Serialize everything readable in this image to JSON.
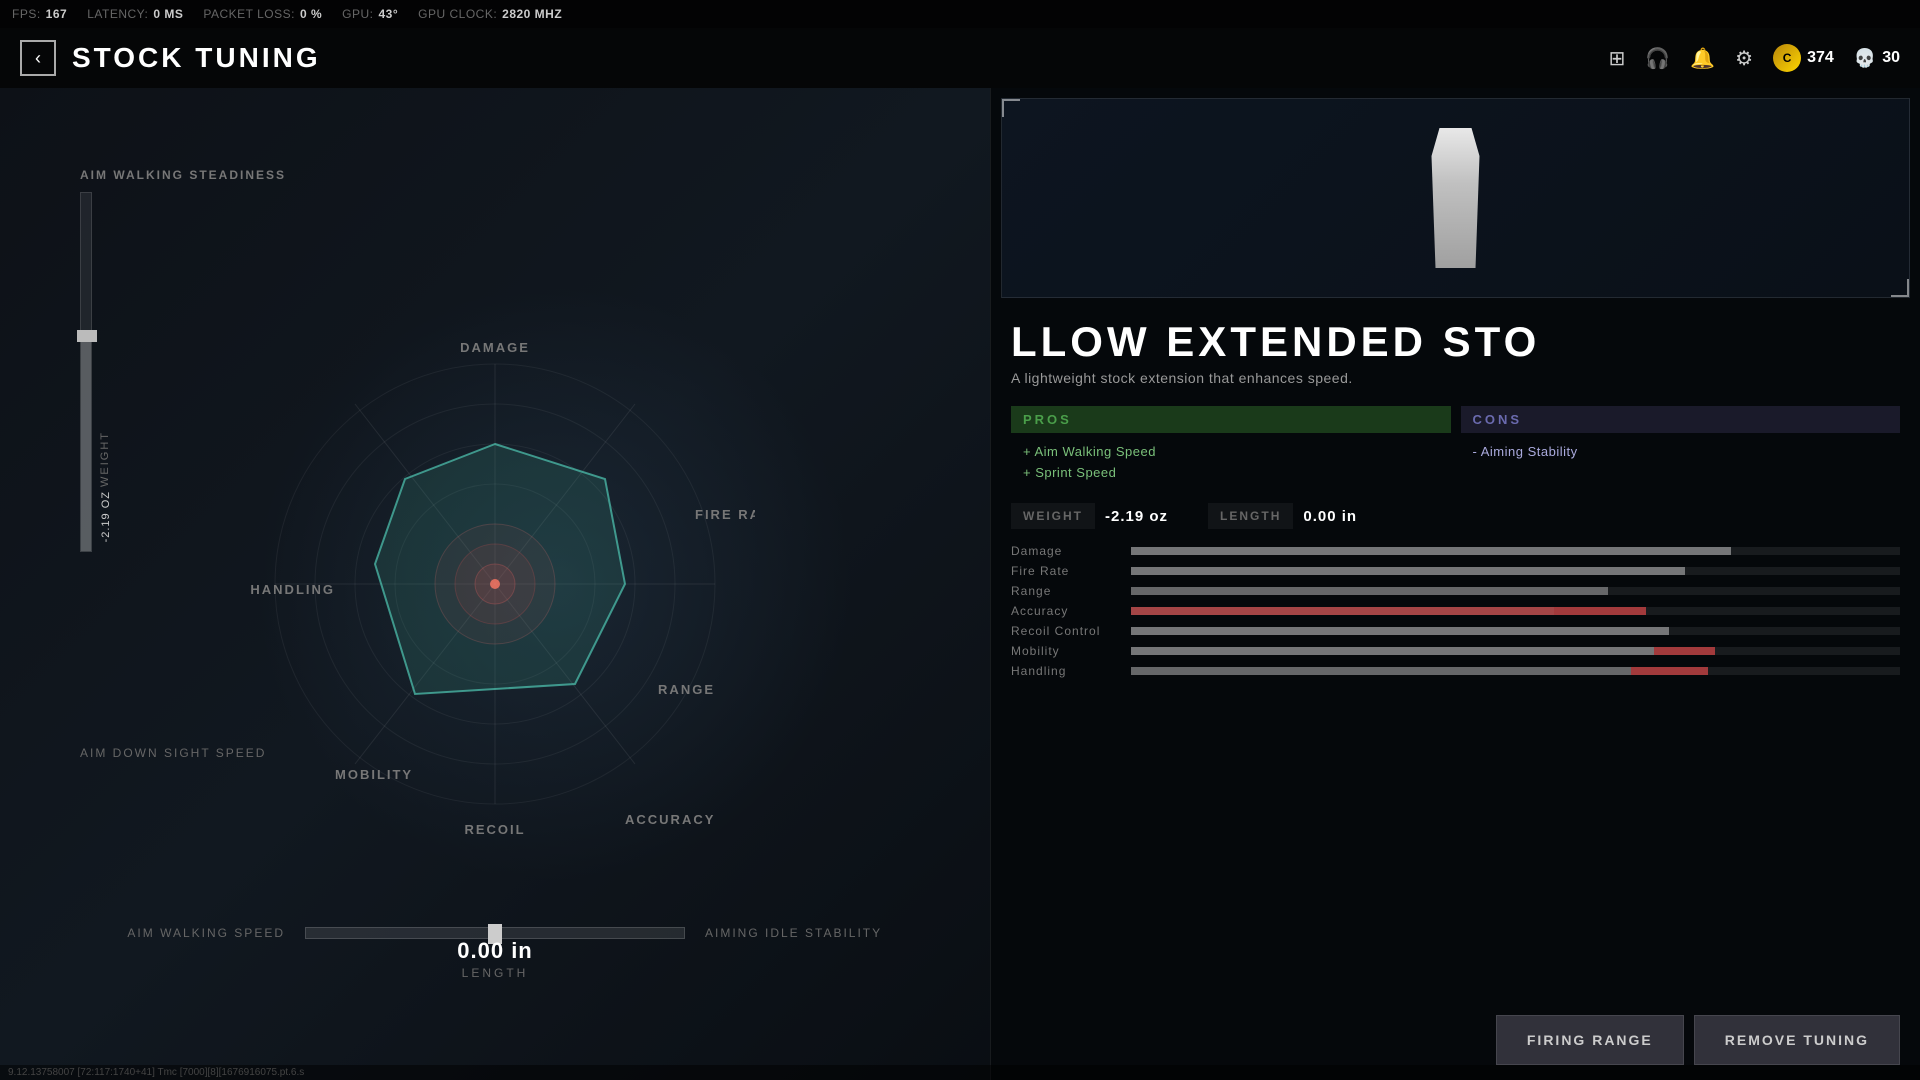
{
  "statusBar": {
    "fps_label": "FPS:",
    "fps_value": "167",
    "latency_label": "LATENCY:",
    "latency_value": "0 MS",
    "packetLoss_label": "PACKET LOSS:",
    "packetLoss_value": "0 %",
    "gpu_label": "GPU:",
    "gpu_value": "43°",
    "gpuClock_label": "GPU CLOCK:",
    "gpuClock_value": "2820 MHZ"
  },
  "header": {
    "back_label": "‹",
    "title": "STOCK TUNING",
    "currency_value": "374",
    "skulls_value": "30"
  },
  "radar": {
    "labels": {
      "damage": "DAMAGE",
      "fire_rate": "FIRE RATE",
      "handling": "HANDLING",
      "range": "RANGE",
      "accuracy": "ACCURACY",
      "recoil": "RECOIL",
      "mobility": "MOBILITY"
    }
  },
  "leftPanel": {
    "aim_walking_steadiness": "AIM WALKING STEADINESS",
    "aim_down_sight_speed": "AIM DOWN SIGHT SPEED",
    "aim_walking_speed": "AIM WALKING SPEED",
    "aiming_idle_stability": "AIMING IDLE STABILITY",
    "weight_label": "WEIGHT",
    "weight_value": "-2.19 OZ",
    "length_value": "0.00 in",
    "length_label": "LENGTH"
  },
  "rightPanel": {
    "item_title": "LLOW EXTENDED STO",
    "item_full_title": "HOLLOW EXTENDED STOCK",
    "item_description": "A lightweight stock extension that enhances speed.",
    "pros_header": "PROS",
    "cons_header": "CONS",
    "pros": [
      "+ Aim Walking Speed",
      "+ Sprint Speed"
    ],
    "cons": [
      "- Aiming Stability"
    ],
    "weight_label": "WEIGHT",
    "weight_value": "-2.19 oz",
    "length_label": "LENGTH",
    "length_value": "0.00 in",
    "stats": [
      {
        "name": "Damage",
        "fill": 78,
        "delta": 0,
        "highlight": false
      },
      {
        "name": "Fire Rate",
        "fill": 72,
        "delta": 0,
        "highlight": false
      },
      {
        "name": "Range",
        "fill": 62,
        "delta": 0,
        "highlight": false
      },
      {
        "name": "Accuracy",
        "fill": 55,
        "delta": 12,
        "highlight": true
      },
      {
        "name": "Recoil Control",
        "fill": 70,
        "delta": 0,
        "highlight": false
      },
      {
        "name": "Mobility",
        "fill": 68,
        "delta": 8,
        "highlight": false
      },
      {
        "name": "Handling",
        "fill": 65,
        "delta": 10,
        "highlight": false
      }
    ],
    "firing_range_label": "FIRING RANGE",
    "remove_tuning_label": "REMOVE TUNING"
  },
  "debugInfo": "9.12.13758007 [72:117:1740+41] Tmc [7000][8][1676916075.pt.6.s"
}
